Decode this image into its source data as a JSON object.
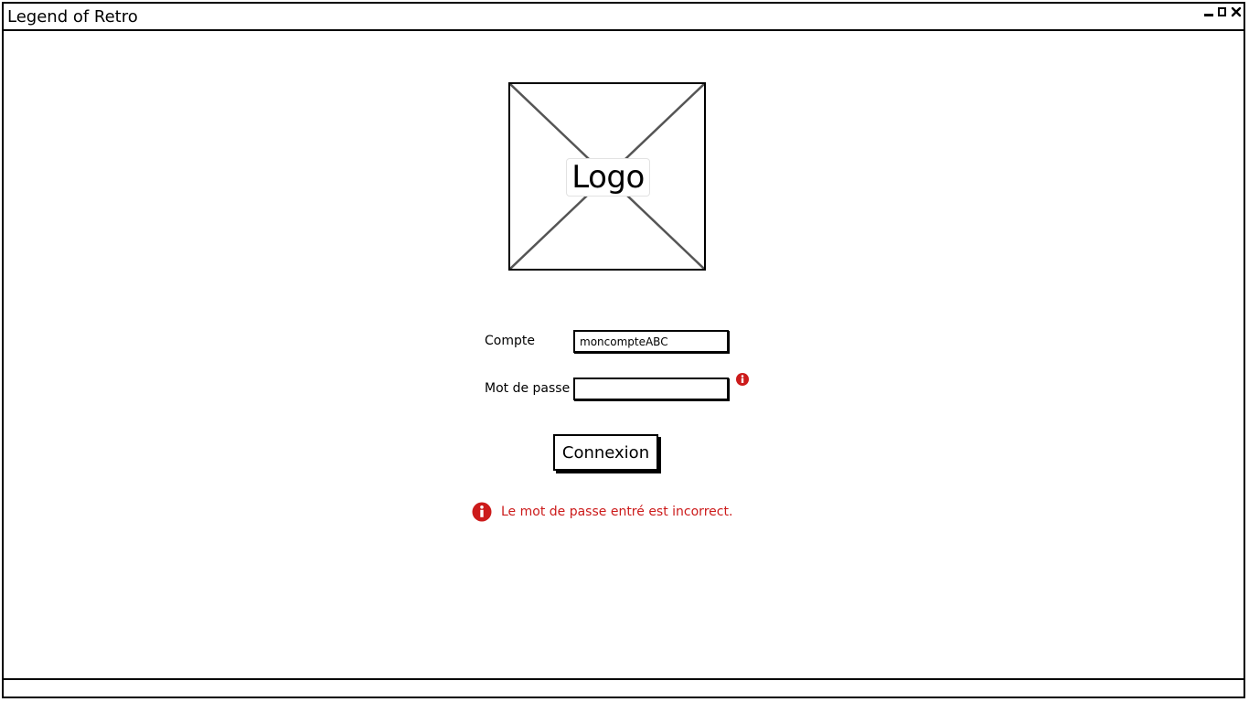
{
  "window": {
    "title": "Legend of Retro",
    "controls": [
      "minimize-icon",
      "maximize-icon",
      "close-icon"
    ]
  },
  "logo": {
    "label": "Logo"
  },
  "form": {
    "account_label": "Compte",
    "account_value": "moncompteABC",
    "password_label": "Mot de passe",
    "password_value": "",
    "submit_label": "Connexion"
  },
  "error": {
    "message": "Le mot de passe entré est incorrect.",
    "icon": "info-icon"
  },
  "colors": {
    "error": "#cc1b1b",
    "border": "#000000",
    "background": "#ffffff"
  }
}
